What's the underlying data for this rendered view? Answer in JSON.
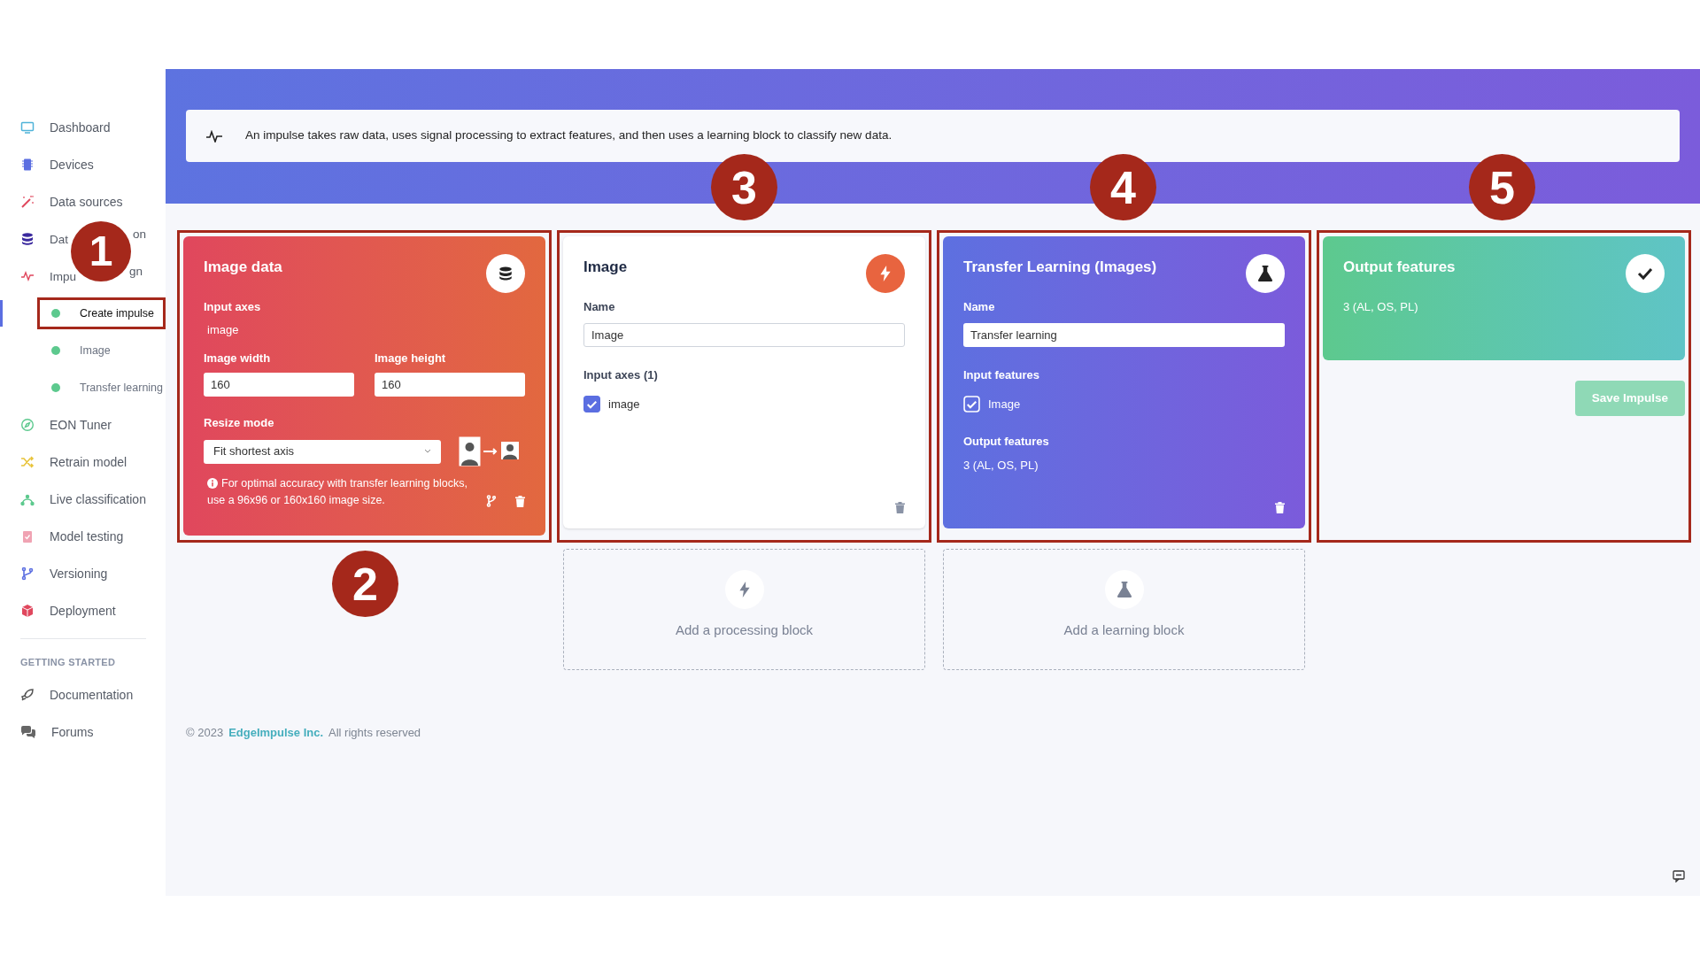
{
  "sidebar": {
    "items": [
      {
        "label": "Dashboard",
        "selected": false
      },
      {
        "label": "Devices",
        "selected": false
      },
      {
        "label": "Data sources",
        "selected": false
      },
      {
        "label_visible": [
          "Dat",
          "on"
        ],
        "selected": false
      },
      {
        "label_visible": [
          "Impu",
          "gn"
        ],
        "selected": false,
        "children": [
          {
            "label": "Create impulse",
            "selected": true
          },
          {
            "label": "Image",
            "selected": false
          },
          {
            "label": "Transfer learning",
            "selected": false
          }
        ]
      },
      {
        "label": "EON Tuner",
        "selected": false
      },
      {
        "label": "Retrain model",
        "selected": false
      },
      {
        "label": "Live classification",
        "selected": false
      },
      {
        "label": "Model testing",
        "selected": false
      },
      {
        "label": "Versioning",
        "selected": false
      },
      {
        "label": "Deployment",
        "selected": false
      }
    ],
    "section_title": "GETTING STARTED",
    "section_items": [
      {
        "label": "Documentation",
        "selected": false
      },
      {
        "label": "Forums",
        "selected": false
      }
    ]
  },
  "notice": {
    "text": "An impulse takes raw data, uses signal processing to extract features, and then uses a learning block to classify new data."
  },
  "blocks": [
    {
      "kind": "input",
      "title": "Image data",
      "axes_label": "Input axes",
      "axes_value": "image",
      "width_label": "Image width",
      "width_value": "160",
      "height_label": "Image height",
      "height_value": "160",
      "resize_label": "Resize mode",
      "resize_value": "Fit shortest axis",
      "info": "For optimal accuracy with transfer learning blocks, use a 96x96 or 160x160 image size."
    },
    {
      "kind": "processing",
      "title": "Image",
      "name_label": "Name",
      "name_value": "Image",
      "axes_label": "Input axes (1)",
      "axes": [
        {
          "label": "image",
          "checked": true
        }
      ]
    },
    {
      "kind": "learning",
      "title": "Transfer Learning (Images)",
      "name_label": "Name",
      "name_value": "Transfer learning",
      "features_label": "Input features",
      "features": [
        {
          "label": "Image",
          "checked": true
        }
      ],
      "output_label": "Output features",
      "output_value": "3 (AL, OS, PL)"
    },
    {
      "kind": "output",
      "title": "Output features",
      "value": "3 (AL, OS, PL)"
    }
  ],
  "save_button": {
    "label": "Save Impulse",
    "disabled": true
  },
  "add_blocks": [
    {
      "kind": "processing",
      "label": "Add a processing block"
    },
    {
      "kind": "learning",
      "label": "Add a learning block"
    }
  ],
  "footer": {
    "copyright": "© 2023",
    "company": "EdgeImpulse Inc.",
    "rights": "All rights reserved"
  },
  "annotations": [
    "1",
    "2",
    "3",
    "4",
    "5"
  ]
}
